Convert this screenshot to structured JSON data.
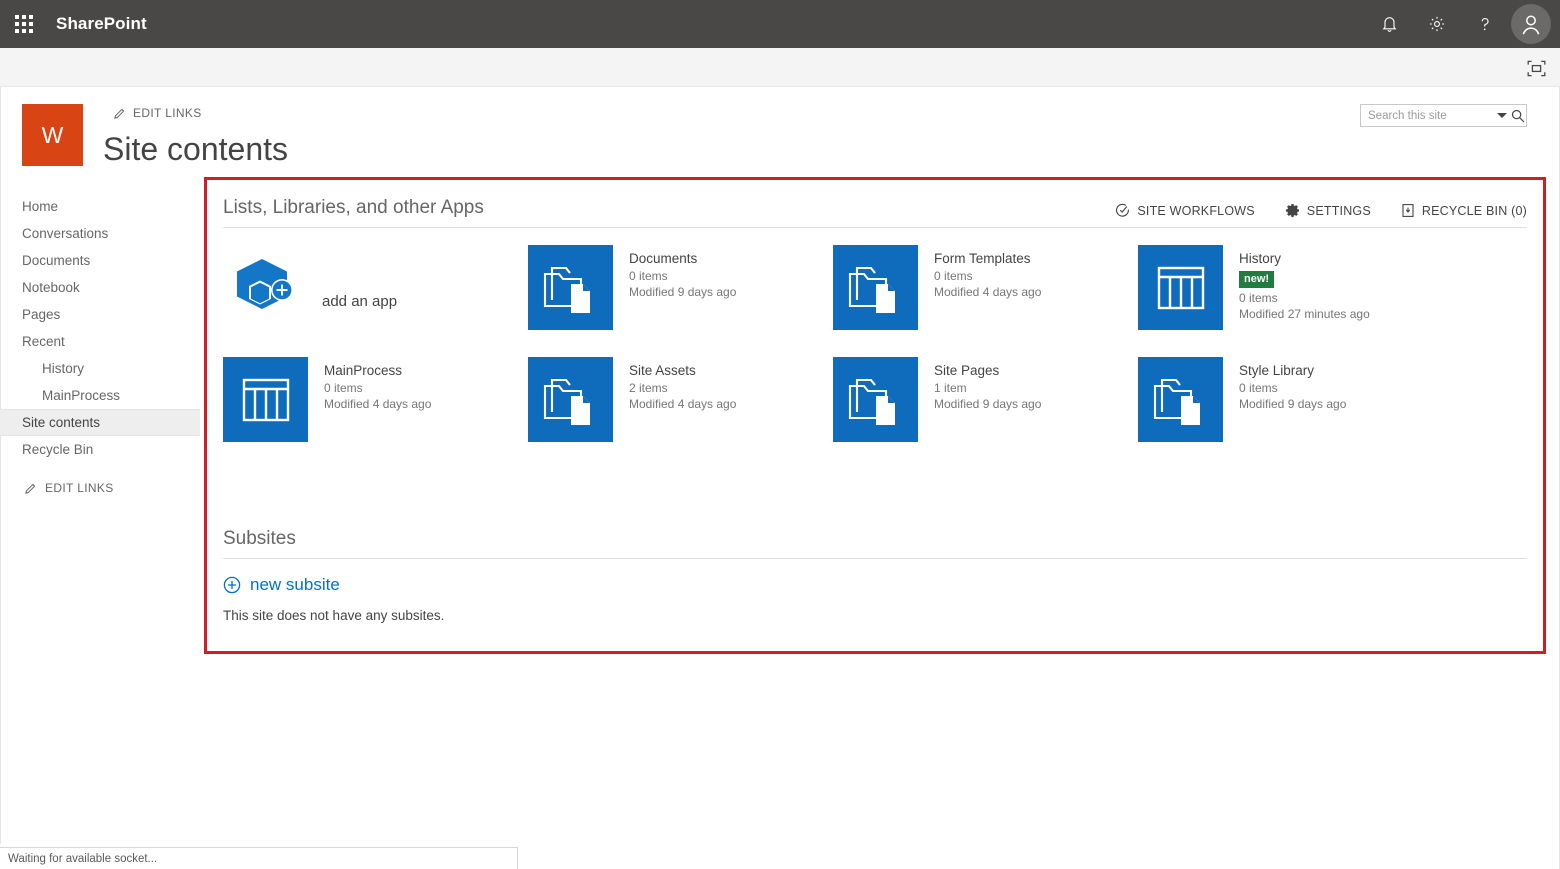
{
  "suite_bar": {
    "waffle_icon": "app-launcher-waffle-icon",
    "brand": "SharePoint",
    "icons": [
      {
        "name": "notifications-bell-icon",
        "label": "Notifications"
      },
      {
        "name": "settings-gear-icon",
        "label": "Settings"
      },
      {
        "name": "help-question-icon",
        "label": "Help"
      }
    ],
    "avatar": {
      "name": "user-avatar",
      "label": "Me"
    }
  },
  "ribbon_strip": {
    "focus_on_content_icon": "focus-on-content-icon"
  },
  "site_header": {
    "logo_letter": "W",
    "edit_links_label": "EDIT LINKS",
    "edit_links_icon": "pencil-icon",
    "title": "Site contents"
  },
  "search": {
    "placeholder": "Search this site",
    "value": "",
    "caret_icon": "chevron-down-icon",
    "search_icon": "search-icon"
  },
  "sidebar": {
    "items": [
      {
        "label": "Home",
        "level": 0,
        "selected": false
      },
      {
        "label": "Conversations",
        "level": 0,
        "selected": false
      },
      {
        "label": "Documents",
        "level": 0,
        "selected": false
      },
      {
        "label": "Notebook",
        "level": 0,
        "selected": false
      },
      {
        "label": "Pages",
        "level": 0,
        "selected": false
      },
      {
        "label": "Recent",
        "level": 0,
        "selected": false
      },
      {
        "label": "History",
        "level": 1,
        "selected": false
      },
      {
        "label": "MainProcess",
        "level": 1,
        "selected": false
      },
      {
        "label": "Site contents",
        "level": 0,
        "selected": true
      },
      {
        "label": "Recycle Bin",
        "level": 0,
        "selected": false
      }
    ],
    "edit_links_label": "EDIT LINKS",
    "edit_links_icon": "pencil-icon"
  },
  "main": {
    "apps_section": {
      "title": "Lists, Libraries, and other Apps",
      "actions": [
        {
          "label": "SITE WORKFLOWS",
          "icon": "site-workflows-icon"
        },
        {
          "label": "SETTINGS",
          "icon": "settings-gear-icon"
        },
        {
          "label": "RECYCLE BIN (0)",
          "icon": "recycle-bin-icon"
        }
      ],
      "add_app": {
        "label": "add an app",
        "icon": "add-an-app-icon"
      },
      "tiles": [
        {
          "name": "Documents",
          "icon": "document-library-icon",
          "items": "0 items",
          "modified": "Modified 9 days ago",
          "badge": ""
        },
        {
          "name": "Form Templates",
          "icon": "document-library-icon",
          "items": "0 items",
          "modified": "Modified 4 days ago",
          "badge": ""
        },
        {
          "name": "History",
          "icon": "list-icon",
          "items": "0 items",
          "modified": "Modified 27 minutes ago",
          "badge": "new!"
        },
        {
          "name": "MainProcess",
          "icon": "list-icon",
          "items": "0 items",
          "modified": "Modified 4 days ago",
          "badge": ""
        },
        {
          "name": "Site Assets",
          "icon": "document-library-icon",
          "items": "2 items",
          "modified": "Modified 4 days ago",
          "badge": ""
        },
        {
          "name": "Site Pages",
          "icon": "document-library-icon",
          "items": "1 item",
          "modified": "Modified 9 days ago",
          "badge": ""
        },
        {
          "name": "Style Library",
          "icon": "document-library-icon",
          "items": "0 items",
          "modified": "Modified 9 days ago",
          "badge": ""
        }
      ]
    },
    "subsites_section": {
      "title": "Subsites",
      "new_subsite_label": "new subsite",
      "new_subsite_icon": "plus-circle-icon",
      "empty_message": "This site does not have any subsites."
    }
  },
  "status_bar": {
    "text": "Waiting for available socket..."
  },
  "colors": {
    "suite_bar": "#4a4846",
    "site_logo": "#d94415",
    "tile_blue": "#0f6cbd",
    "link_blue": "#0072c6",
    "badge_green": "#217c41",
    "annotation_red": "#cc2027"
  }
}
